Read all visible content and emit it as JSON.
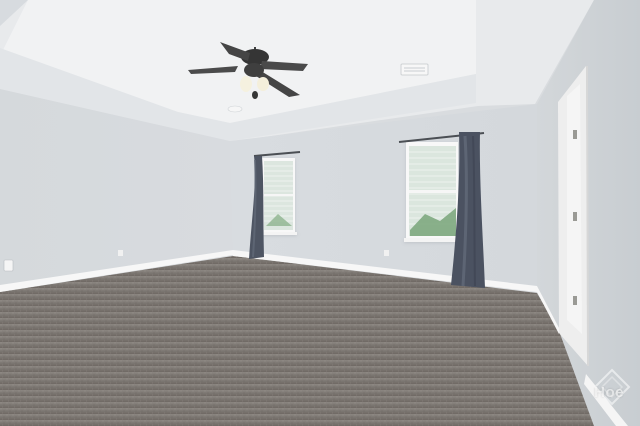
{
  "scene": {
    "description_label": "",
    "watermark": {
      "text": "Hoe"
    }
  },
  "colors": {
    "ceiling": "#e7e9eb",
    "tray_ceiling": "#f2f3f4",
    "left_wall": "#d4d8db",
    "center_wall": "#d9dde1",
    "right_wall": "#cfd4d8",
    "baseboard": "#f6f6f6",
    "carpet": "#7a7470",
    "curtain": "#4d5460",
    "window_frame": "#f7f7f7",
    "window_glass": "#dfe8e2",
    "door_frame": "#efefef"
  }
}
